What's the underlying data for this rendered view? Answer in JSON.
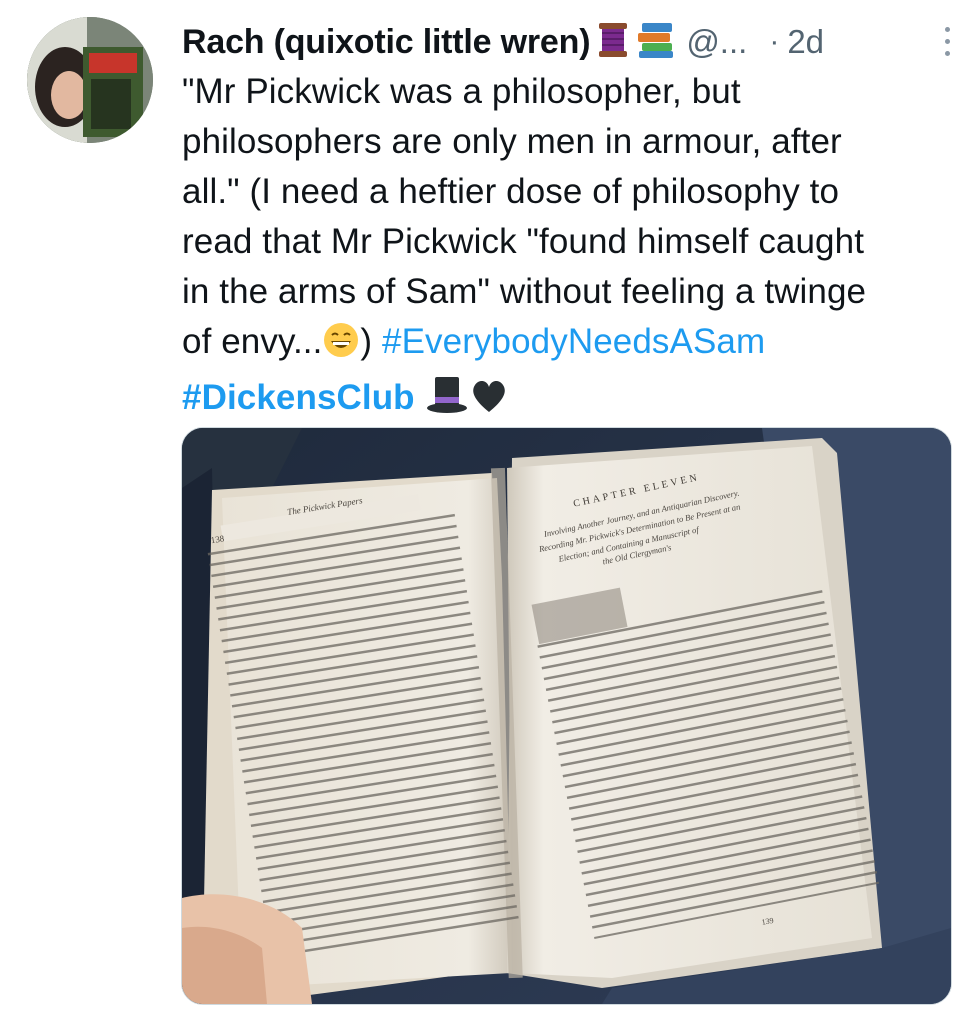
{
  "tweet": {
    "author_name": "Rach (quixotic little wren)",
    "author_emoji_1": "thread-spool-emoji",
    "author_emoji_2": "books-emoji",
    "handle": "@...",
    "separator": "·",
    "time": "2d",
    "text_lines": [
      "\"Mr Pickwick was a philosopher, but",
      "philosophers are only men in armour, after",
      "all.\" (I need a heftier dose of philosophy to",
      "read that Mr Pickwick \"found himself caught",
      "in the arms of Sam\" without feeling a twinge",
      "of envy..."
    ],
    "text_after_emoji": ") ",
    "hashtag_1": "#EverybodyNeedsASam",
    "hashtag_2": "#DickensClub",
    "trailing_emojis": [
      "grinning-face-emoji",
      "top-hat-emoji",
      "black-heart-emoji"
    ]
  },
  "media": {
    "book": {
      "left_running_head": "The Pickwick Papers",
      "left_page_number": "138",
      "chapter_heading": "CHAPTER ELEVEN",
      "chapter_summary_1": "Involving Another Journey, and an Antiquarian Discovery.",
      "chapter_summary_2": "Recording Mr. Pickwick's Determination to Be Present at an",
      "chapter_summary_3": "Election; and Containing a Manuscript of",
      "chapter_summary_4": "the Old Clergyman's",
      "right_page_number": "139"
    }
  },
  "colors": {
    "link": "#1d9bf0",
    "secondary_text": "#536471",
    "primary_text": "#0f1419"
  }
}
